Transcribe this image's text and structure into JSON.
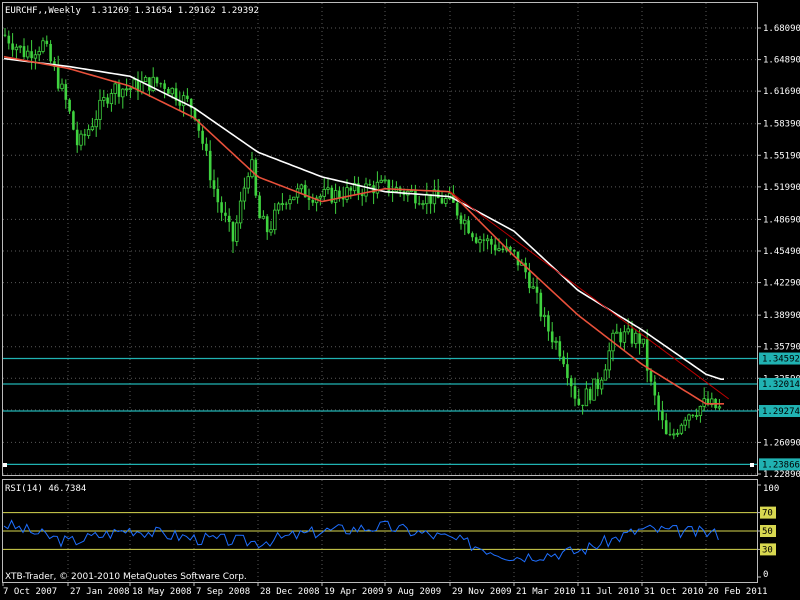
{
  "header": {
    "symbol": "EURCHF,,Weekly",
    "ohlc": "1.31269 1.31654 1.29162 1.29392"
  },
  "rsi_panel": {
    "title": "RSI(14) 46.7384",
    "level_labels": [
      "100",
      "70",
      "50",
      "30",
      "0"
    ],
    "levels": [
      100,
      70,
      50,
      30,
      0
    ],
    "copyright": "XTB-Trader, © 2001-2010 MetaQuotes Software Corp."
  },
  "price_axis": {
    "ticks": [
      "1.68090",
      "1.64890",
      "1.61690",
      "1.58390",
      "1.55190",
      "1.51990",
      "1.48690",
      "1.45490",
      "1.42290",
      "1.38990",
      "1.35790",
      "1.32590",
      "1.29390",
      "1.26090",
      "1.22890"
    ]
  },
  "hlines": [
    {
      "value": 1.34592,
      "label": "1.34592"
    },
    {
      "value": 1.32014,
      "label": "1.32014"
    },
    {
      "value": 1.29274,
      "label": "1.29274"
    },
    {
      "value": 1.23866,
      "label": "1.23866"
    }
  ],
  "time_axis": {
    "labels": [
      "7 Oct 2007",
      "27 Jan 2008",
      "18 May 2008",
      "7 Sep 2008",
      "28 Dec 2008",
      "19 Apr 2009",
      "9 Aug 2009",
      "29 Nov 2009",
      "21 Mar 2010",
      "11 Jul 2010",
      "31 Oct 2010",
      "20 Feb 2011"
    ]
  },
  "colors": {
    "background": "#000000",
    "grid": "#5a5a5a",
    "bull_candle": "#3fd23f",
    "bear_candle": "#3fd23f",
    "ma_fast": "#e8503a",
    "ma_slow": "#ffffff",
    "trendline": "#c00000",
    "hline": "#20b2b2",
    "rsi_line": "#1e6fff",
    "rsi_level": "#d8d850",
    "label_bg": "#20b2b2"
  },
  "chart_data": {
    "type": "candlestick",
    "x_range": [
      "7 Oct 2007",
      "Mar 2011"
    ],
    "y_range": [
      1.2289,
      1.6809
    ],
    "price_anchors": [
      [
        "7 Oct 2007",
        1.675
      ],
      [
        "Nov 2007",
        1.655
      ],
      [
        "Dec 2007",
        1.665
      ],
      [
        "Jan 2008",
        1.62
      ],
      [
        "27 Jan 2008",
        1.6
      ],
      [
        "Feb 2008",
        1.56
      ],
      [
        "Mar 2008",
        1.59
      ],
      [
        "Apr 2008",
        1.62
      ],
      [
        "18 May 2008",
        1.62
      ],
      [
        "Jun 2008",
        1.625
      ],
      [
        "Jul 2008",
        1.625
      ],
      [
        "Aug 2008",
        1.61
      ],
      [
        "7 Sep 2008",
        1.6
      ],
      [
        "Oct 2008",
        1.51
      ],
      [
        "Nov 2008",
        1.465
      ],
      [
        "Dec 2008",
        1.55
      ],
      [
        "28 Dec 2008",
        1.49
      ],
      [
        "Jan 2009",
        1.475
      ],
      [
        "Feb 2009",
        1.51
      ],
      [
        "Mar 2009",
        1.515
      ],
      [
        "19 Apr 2009",
        1.51
      ],
      [
        "Jun 2009",
        1.515
      ],
      [
        "Jul 2009",
        1.52
      ],
      [
        "9 Aug 2009",
        1.52
      ],
      [
        "Oct 2009",
        1.51
      ],
      [
        "29 Nov 2009",
        1.505
      ],
      [
        "Jan 2010",
        1.47
      ],
      [
        "21 Mar 2010",
        1.45
      ],
      [
        "Apr 2010",
        1.43
      ],
      [
        "May 2010",
        1.38
      ],
      [
        "Jun 2010",
        1.35
      ],
      [
        "11 Jul 2010",
        1.3
      ],
      [
        "Aug 2010",
        1.32
      ],
      [
        "Sep 2010",
        1.37
      ],
      [
        "31 Oct 2010",
        1.365
      ],
      [
        "Nov 2010",
        1.32
      ],
      [
        "Dec 2010",
        1.26
      ],
      [
        "Jan 2011",
        1.29
      ],
      [
        "20 Feb 2011",
        1.3
      ],
      [
        "Mar 2011",
        1.294
      ]
    ],
    "ma_fast_anchors": [
      [
        "7 Oct 2007",
        1.652
      ],
      [
        "27 Jan 2008",
        1.64
      ],
      [
        "18 May 2008",
        1.622
      ],
      [
        "7 Sep 2008",
        1.59
      ],
      [
        "28 Dec 2008",
        1.53
      ],
      [
        "19 Apr 2009",
        1.505
      ],
      [
        "9 Aug 2009",
        1.518
      ],
      [
        "29 Nov 2009",
        1.515
      ],
      [
        "21 Mar 2010",
        1.45
      ],
      [
        "11 Jul 2010",
        1.39
      ],
      [
        "31 Oct 2010",
        1.34
      ],
      [
        "20 Feb 2011",
        1.3
      ],
      [
        "Mar 2011",
        1.3
      ]
    ],
    "ma_slow_anchors": [
      [
        "7 Oct 2007",
        1.65
      ],
      [
        "27 Jan 2008",
        1.642
      ],
      [
        "18 May 2008",
        1.632
      ],
      [
        "7 Sep 2008",
        1.6
      ],
      [
        "28 Dec 2008",
        1.555
      ],
      [
        "19 Apr 2009",
        1.53
      ],
      [
        "9 Aug 2009",
        1.515
      ],
      [
        "29 Nov 2009",
        1.51
      ],
      [
        "21 Mar 2010",
        1.475
      ],
      [
        "11 Jul 2010",
        1.415
      ],
      [
        "31 Oct 2010",
        1.375
      ],
      [
        "20 Feb 2011",
        1.33
      ],
      [
        "Mar 2011",
        1.325
      ]
    ],
    "trendline": [
      [
        "29 Nov 2009",
        1.515
      ],
      [
        "Mar 2011",
        1.305
      ]
    ],
    "rsi_anchors": [
      [
        "7 Oct 2007",
        58
      ],
      [
        "27 Jan 2008",
        38
      ],
      [
        "18 May 2008",
        52
      ],
      [
        "7 Sep 2008",
        42
      ],
      [
        "28 Dec 2008",
        38
      ],
      [
        "19 Apr 2009",
        50
      ],
      [
        "9 Aug 2009",
        55
      ],
      [
        "29 Nov 2009",
        42
      ],
      [
        "21 Mar 2010",
        22
      ],
      [
        "11 Jul 2010",
        28
      ],
      [
        "31 Oct 2010",
        52
      ],
      [
        "20 Feb 2011",
        48
      ],
      [
        "Mar 2011",
        46.7
      ]
    ],
    "rsi_current": 46.7384
  }
}
